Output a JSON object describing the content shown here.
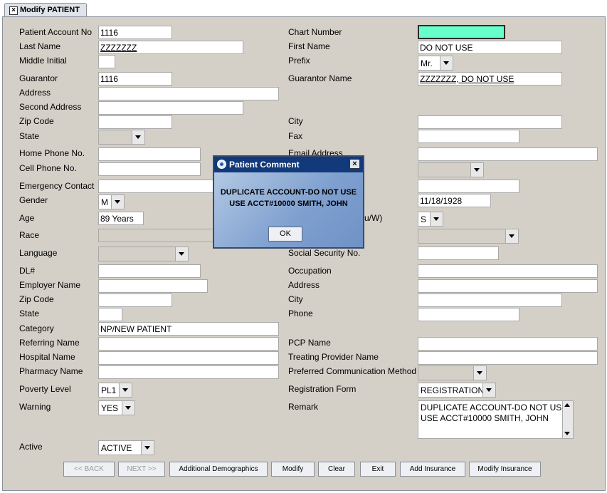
{
  "tab": {
    "label": "Modify PATIENT",
    "close_icon": "×"
  },
  "labels": {
    "patient_account_no": "Patient Account No",
    "last_name": "Last Name",
    "middle_initial": "Middle Initial",
    "guarantor": "Guarantor",
    "address": "Address",
    "second_address": "Second Address",
    "zip_code": "Zip Code",
    "state": "State",
    "home_phone": "Home Phone No.",
    "cell_phone": "Cell Phone No.",
    "emergency_contact": "Emergency Contact",
    "gender": "Gender",
    "age": "Age",
    "race": "Race",
    "language": "Language",
    "dl": "DL#",
    "employer_name": "Employer Name",
    "emp_zip_code": "Zip Code",
    "emp_state": "State",
    "category": "Category",
    "referring_name": "Referring Name",
    "hospital_name": "Hospital Name",
    "pharmacy_name": "Pharmacy Name",
    "poverty_level": "Poverty Level",
    "warning": "Warning",
    "active": "Active",
    "chart_number": "Chart Number",
    "first_name": "First Name",
    "prefix": "Prefix",
    "guarantor_name": "Guarantor Name",
    "city": "City",
    "fax": "Fax",
    "email_address": "Email Address",
    "marital_partial": "u/W)",
    "social_security": "Social Security No.",
    "occupation": "Occupation",
    "emp_address": "Address",
    "emp_city": "City",
    "phone": "Phone",
    "pcp_name": "PCP Name",
    "treating_provider": "Treating Provider Name",
    "preferred_comm": "Preferred Communication Method",
    "registration_form": "Registration Form",
    "remark": "Remark"
  },
  "values": {
    "patient_account_no": "1116",
    "last_name": "ZZZZZZZ",
    "middle_initial": "",
    "guarantor": "1116",
    "address": "",
    "second_address": "",
    "zip_code": "",
    "home_phone": "",
    "cell_phone": "",
    "emergency_contact": "",
    "gender": "M",
    "age": "89 Years",
    "category": "NP/NEW PATIENT",
    "poverty_level": "PL1",
    "warning": "YES",
    "active": "ACTIVE",
    "chart_number": "",
    "first_name": "DO NOT USE",
    "prefix": "Mr.",
    "guarantor_name": "ZZZZZZZ, DO NOT USE",
    "dob": "11/18/1928",
    "marital": "S",
    "registration_form": "REGISTRATION",
    "remark_line1": "DUPLICATE ACCOUNT-DO NOT USE",
    "remark_line2": "USE ACCT#10000 SMITH, JOHN"
  },
  "buttons": {
    "back": "<< BACK",
    "next": "NEXT >>",
    "additional_demographics": "Additional Demographics",
    "modify": "Modify",
    "clear": "Clear",
    "exit": "Exit",
    "add_insurance": "Add Insurance",
    "modify_insurance": "Modify Insurance"
  },
  "dialog": {
    "title": "Patient Comment",
    "message_line1": "DUPLICATE ACCOUNT-DO NOT USE",
    "message_line2": "USE ACCT#10000 SMITH, JOHN",
    "ok": "OK",
    "close_icon": "×"
  },
  "colors": {
    "panel": "#d4d0c8",
    "chart_number_field": "#66ffcc",
    "dialog_title": "#123a7a"
  }
}
